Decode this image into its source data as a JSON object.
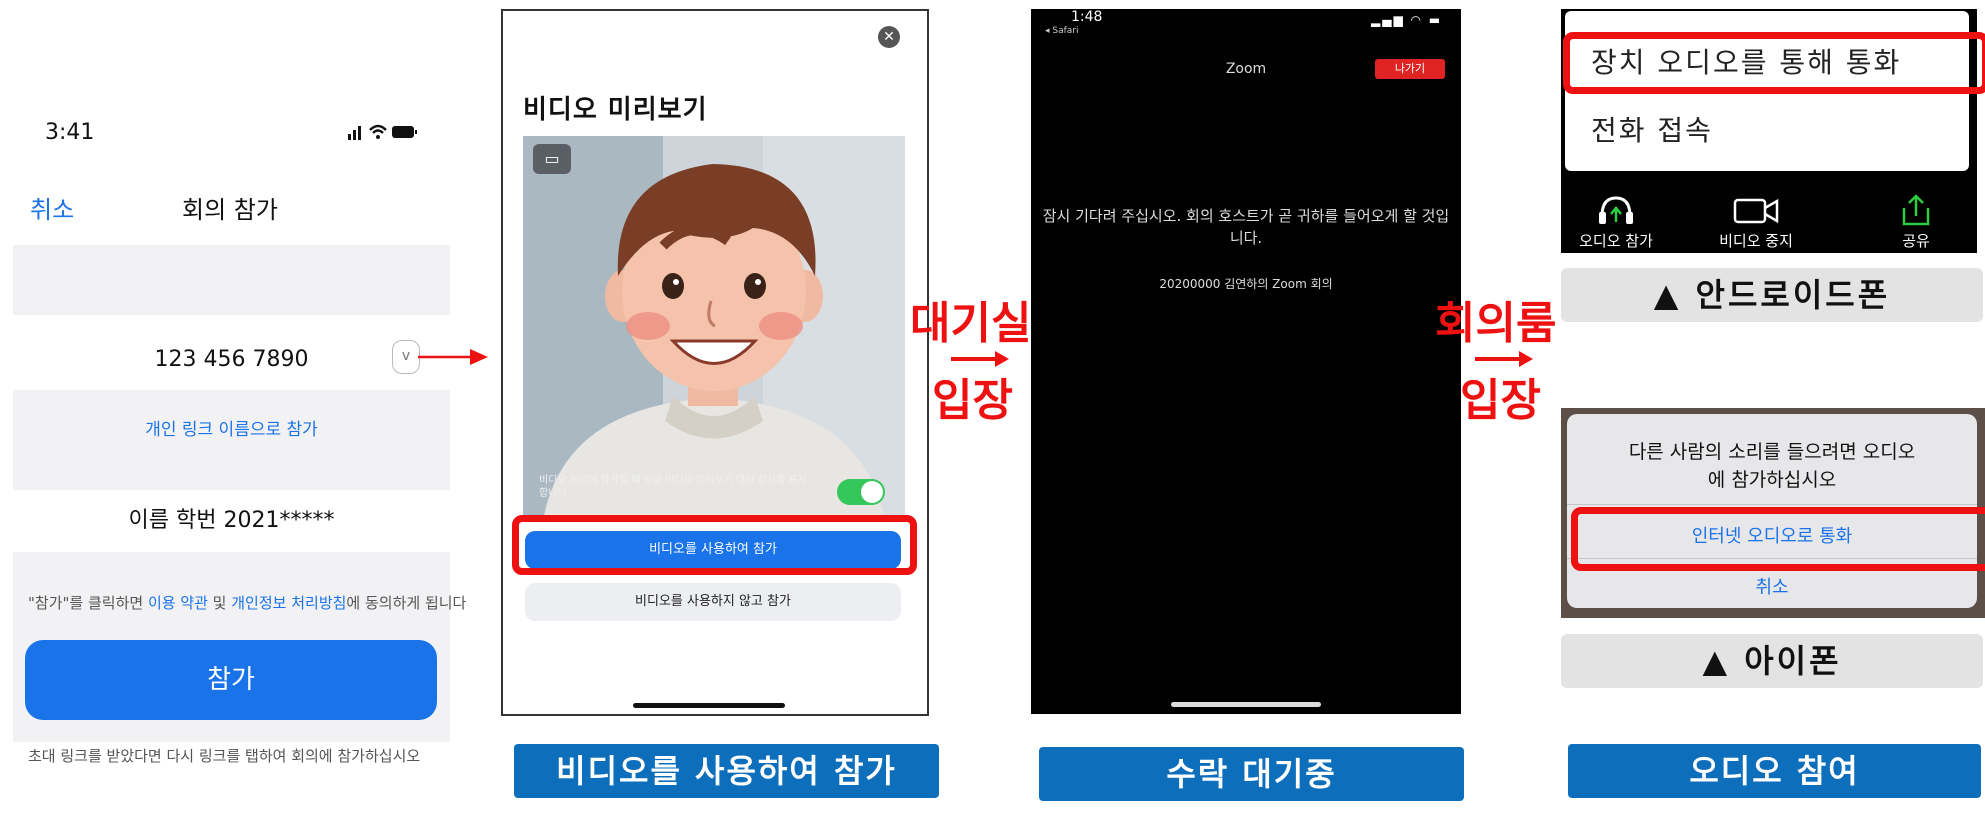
{
  "join_screen": {
    "status_time": "3:41",
    "cancel_label": "취소",
    "title": "회의 참가",
    "meeting_id": "123 456 7890",
    "personal_link_label": "개인 링크 이름으로 참가",
    "name_value": "이름 학번 2021*****",
    "terms_prefix": "\"참가\"를 클릭하면 ",
    "terms_link1": "이용 약관",
    "terms_mid": " 및 ",
    "terms_link2": "개인정보 처리방침",
    "terms_suffix": "에 동의하게 됩니다",
    "join_label": "참가",
    "invite_hint": "초대 링크를 받았다면 다시 링크를 탭하여 회의에 참가하십시오"
  },
  "preview_screen": {
    "heading": "비디오 미리보기",
    "toggle_text": "비디오 회의에 참가할 때 항상 비디오 미리보기 대화 상자를 표시합니다",
    "join_with_video": "비디오를 사용하여 참가",
    "join_without_video": "비디오를 사용하지 않고 참가"
  },
  "flow": {
    "step1_line1": "대기실",
    "step1_line2": "입장",
    "step2_line1": "회의룸",
    "step2_line2": "입장"
  },
  "waiting_screen": {
    "status_time": "1:48",
    "back_label": "◂ Safari",
    "title": "Zoom",
    "leave_label": "나가기",
    "message": "잠시 기다려 주십시오. 회의 호스트가 곧 귀하를 들어오게 할 것입니다.",
    "meeting_name": "20200000 김연하의 Zoom 회의"
  },
  "audio_android": {
    "menu_items": [
      "장치 오디오를 통해 통화",
      "전화 접속"
    ],
    "toolbar": [
      "오디오 참가",
      "비디오 중지",
      "공유"
    ],
    "badge": "▲ 안드로이드폰"
  },
  "audio_ios": {
    "prompt": "다른 사람의 소리를 들으려면 오디오에 참가하십시오",
    "internet_audio": "인터넷 오디오로 통화",
    "cancel": "취소",
    "badge": "▲ 아이폰"
  },
  "captions": [
    "비디오를 사용하여 참가",
    "수락 대기중",
    "오디오 참여"
  ],
  "colors": {
    "accent_blue": "#1a73e8",
    "highlight_red": "#ee1111",
    "caption_blue": "#0d6ebc"
  }
}
